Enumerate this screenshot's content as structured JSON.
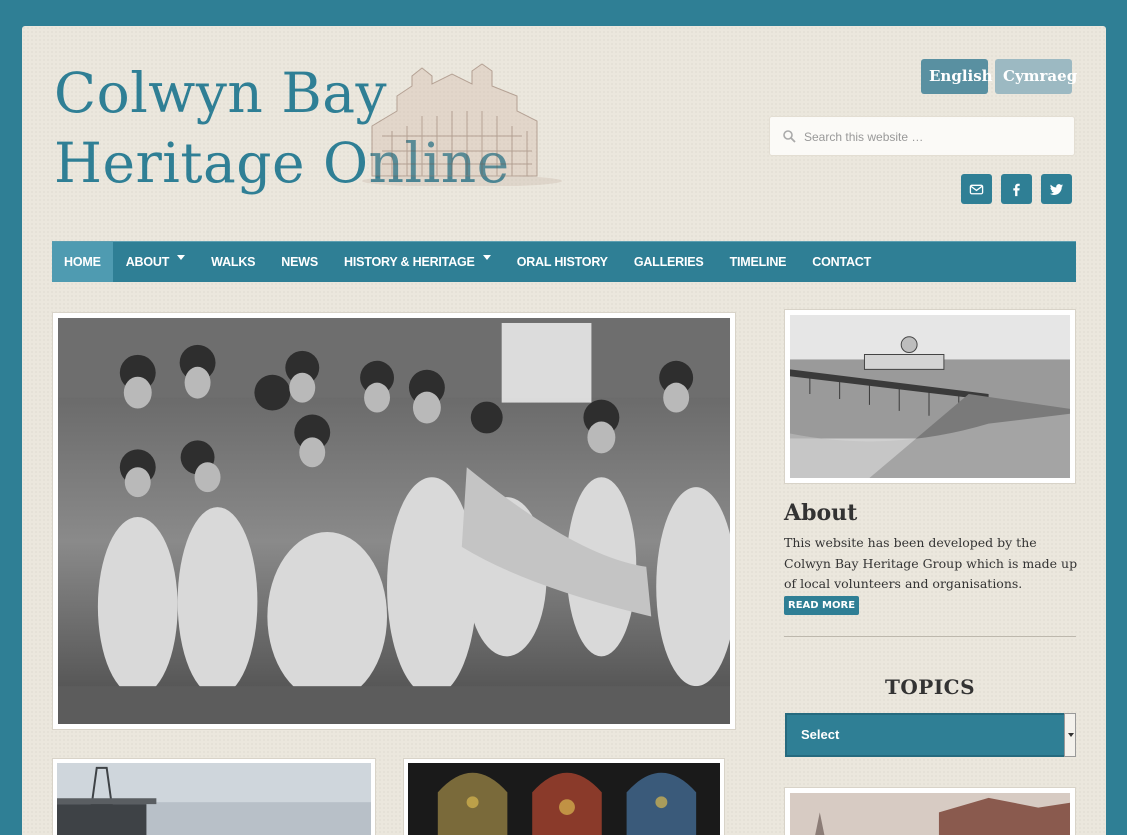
{
  "site": {
    "title_line1": "Colwyn Bay",
    "title_line2": "Heritage Online"
  },
  "header": {
    "languages": [
      {
        "label": "English",
        "active": true
      },
      {
        "label": "Cymraeg",
        "active": false
      }
    ],
    "search": {
      "placeholder": "Search this website …",
      "value": ""
    },
    "social": [
      {
        "name": "email",
        "icon": "mail-icon"
      },
      {
        "name": "facebook",
        "icon": "facebook-icon"
      },
      {
        "name": "twitter",
        "icon": "twitter-icon"
      }
    ]
  },
  "nav": {
    "items": [
      {
        "label": "HOME",
        "active": true,
        "has_submenu": false
      },
      {
        "label": "ABOUT",
        "active": false,
        "has_submenu": true
      },
      {
        "label": "WALKS",
        "active": false,
        "has_submenu": false
      },
      {
        "label": "NEWS",
        "active": false,
        "has_submenu": false
      },
      {
        "label": "HISTORY & HERITAGE",
        "active": false,
        "has_submenu": true
      },
      {
        "label": "ORAL HISTORY",
        "active": false,
        "has_submenu": false
      },
      {
        "label": "GALLERIES",
        "active": false,
        "has_submenu": false
      },
      {
        "label": "TIMELINE",
        "active": false,
        "has_submenu": false
      },
      {
        "label": "CONTACT",
        "active": false,
        "has_submenu": false
      }
    ]
  },
  "sidebar": {
    "about": {
      "title": "About",
      "text": "This website has been developed by the Colwyn Bay Heritage Group which is made up of local volunteers and organisations.",
      "read_more": "READ MORE"
    },
    "topics": {
      "title": "TOPICS",
      "selected": "Select"
    }
  },
  "colors": {
    "brand": "#2f7f95",
    "page_bg": "#ebe7dd",
    "nav_active": "#4f9bb1",
    "lang_active": "#5990a1",
    "lang_inactive": "#9cb9c2"
  }
}
